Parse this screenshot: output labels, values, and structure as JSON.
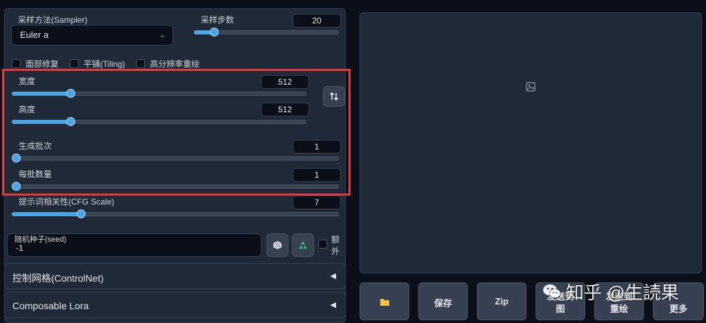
{
  "sampler": {
    "label": "采样方法(Sampler)",
    "value": "Euler a",
    "steps_label": "采样步数",
    "steps_value": "20",
    "steps_fraction": 0.14
  },
  "options": {
    "face_restore": "面部修复",
    "tiling": "平铺(Tiling)",
    "hires_fix": "高分辨率重绘"
  },
  "size": {
    "width_label": "宽度",
    "width_value": "512",
    "width_fraction": 0.2,
    "height_label": "高度",
    "height_value": "512",
    "height_fraction": 0.2,
    "swap_icon": "swap-arrows-icon"
  },
  "batch": {
    "count_label": "生成批次",
    "count_value": "1",
    "count_fraction": 0.0,
    "size_label": "每批数量",
    "size_value": "1",
    "size_fraction": 0.0
  },
  "cfg": {
    "label": "提示词相关性(CFG Scale)",
    "value": "7",
    "fraction": 0.21
  },
  "seed": {
    "label": "随机种子(seed)",
    "value": "-1",
    "dice_icon": "dice-icon",
    "recycle_icon": "recycle-icon",
    "extra_label": "额外"
  },
  "accordions": {
    "controlnet": "控制网格(ControlNet)",
    "composable_lora": "Composable Lora"
  },
  "actions": {
    "open_folder_icon": "folder-icon",
    "save": "保存",
    "zip": "Zip",
    "to_img2img_line1": "发送到",
    "to_img2img_line2": "图",
    "to_inpaint_line1": "发送到",
    "to_inpaint_line2": "重绘",
    "more_line2": "更多"
  },
  "watermark": {
    "text": "知乎 @生読果"
  },
  "colors": {
    "accent": "#4ea5e6",
    "highlight_border": "#e5393b",
    "panel": "#1f2937",
    "background": "#0b0f19"
  }
}
